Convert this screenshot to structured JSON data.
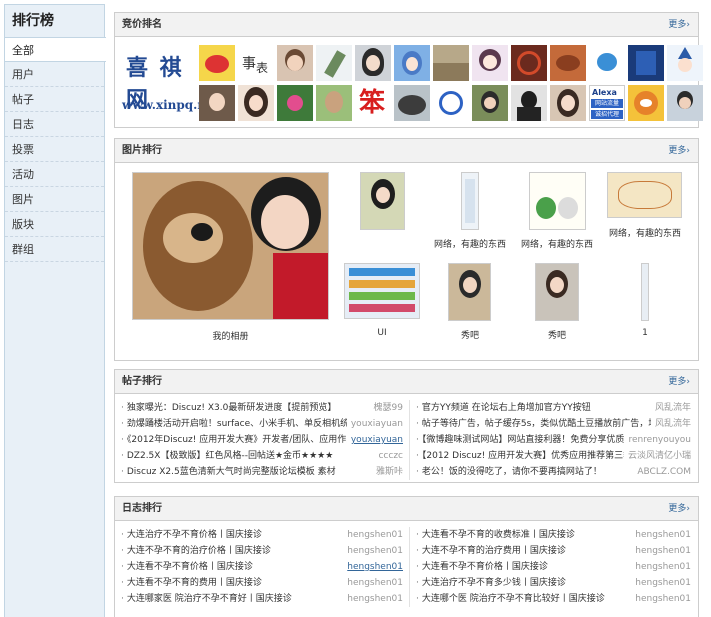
{
  "sidebar": {
    "title": "排行榜",
    "items": [
      {
        "label": "全部"
      },
      {
        "label": "用户"
      },
      {
        "label": "帖子"
      },
      {
        "label": "日志"
      },
      {
        "label": "投票"
      },
      {
        "label": "活动"
      },
      {
        "label": "图片"
      },
      {
        "label": "版块"
      },
      {
        "label": "群组"
      }
    ]
  },
  "competition": {
    "title": "竞价排名",
    "more": "更多›",
    "logo_line1": "喜 祺 网",
    "logo_line2": "www.xinpq.ne",
    "avatar_labels": [
      "Alexa",
      "网站流量",
      "诚招代理"
    ],
    "avatar_char": "笨"
  },
  "images": {
    "title": "图片排行",
    "more": "更多›",
    "items": [
      {
        "label": "我的相册"
      },
      {
        "label": ""
      },
      {
        "label": "网络，有趣的东西"
      },
      {
        "label": "网络，有趣的东西"
      },
      {
        "label": "网络，有趣的东西"
      },
      {
        "label": "UI"
      },
      {
        "label": "秀吧"
      },
      {
        "label": "秀吧"
      },
      {
        "label": "1"
      }
    ]
  },
  "posts": {
    "title": "帖子排行",
    "more": "更多›",
    "left": [
      {
        "title": "独家曝光：Discuz! X3.0最新研发进度【提前预览】",
        "author": "槐瑟99"
      },
      {
        "title": "劲爆踊楼活动开启啦！surface、小米手机、单反相机统统",
        "author": "youxiayuan"
      },
      {
        "title": "《2012年Discuz! 应用开发大赛》开发者/团队、应用作品",
        "author": "youxiayuan"
      },
      {
        "title": "DZ2.5X【极致版】红色风格--回帖送★金币★★★★",
        "author": "ccczc"
      },
      {
        "title": "Discuz X2.5蓝色清新大气时尚完整版论坛模板 素材",
        "author": "雅斯咔"
      }
    ],
    "right": [
      {
        "title": "官方YY频道 在论坛右上角增加官方YY按钮",
        "author": "风乱流年"
      },
      {
        "title": "帖子等待广告，帖子缓存5s，类似优酷土豆播放前广告，增",
        "author": "风乱流年"
      },
      {
        "title": "【微博趣味测试网站】网站直接利器！免费分享优质源",
        "author": "renrenyouyou"
      },
      {
        "title": "【2012 Discuz! 应用开发大赛】优秀应用推荐第三季",
        "author": "云淡风清亿小瑞"
      },
      {
        "title": "老公！饭的没得吃了，请你不要再搞网站了！",
        "author": "ABCLZ.COM"
      }
    ]
  },
  "blogs": {
    "title": "日志排行",
    "more": "更多›",
    "left": [
      {
        "title": "大连治疗不孕不育价格丨国庆接诊",
        "author": "hengshen01"
      },
      {
        "title": "大连不孕不育的治疗价格丨国庆接诊",
        "author": "hengshen01"
      },
      {
        "title": "大连看不孕不育价格丨国庆接诊",
        "author": "hengshen01"
      },
      {
        "title": "大连看不孕不育的费用丨国庆接诊",
        "author": "hengshen01"
      },
      {
        "title": "大连哪家医 院治疗不孕不育好丨国庆接诊",
        "author": "hengshen01"
      }
    ],
    "right": [
      {
        "title": "大连看不孕不育的收费标准丨国庆接诊",
        "author": "hengshen01"
      },
      {
        "title": "大连不孕不育的治疗费用丨国庆接诊",
        "author": "hengshen01"
      },
      {
        "title": "大连看不孕不育价格丨国庆接诊",
        "author": "hengshen01"
      },
      {
        "title": "大连治疗不孕不育多少钱丨国庆接诊",
        "author": "hengshen01"
      },
      {
        "title": "大连哪个医 院治疗不孕不育比较好丨国庆接诊",
        "author": "hengshen01"
      }
    ]
  }
}
